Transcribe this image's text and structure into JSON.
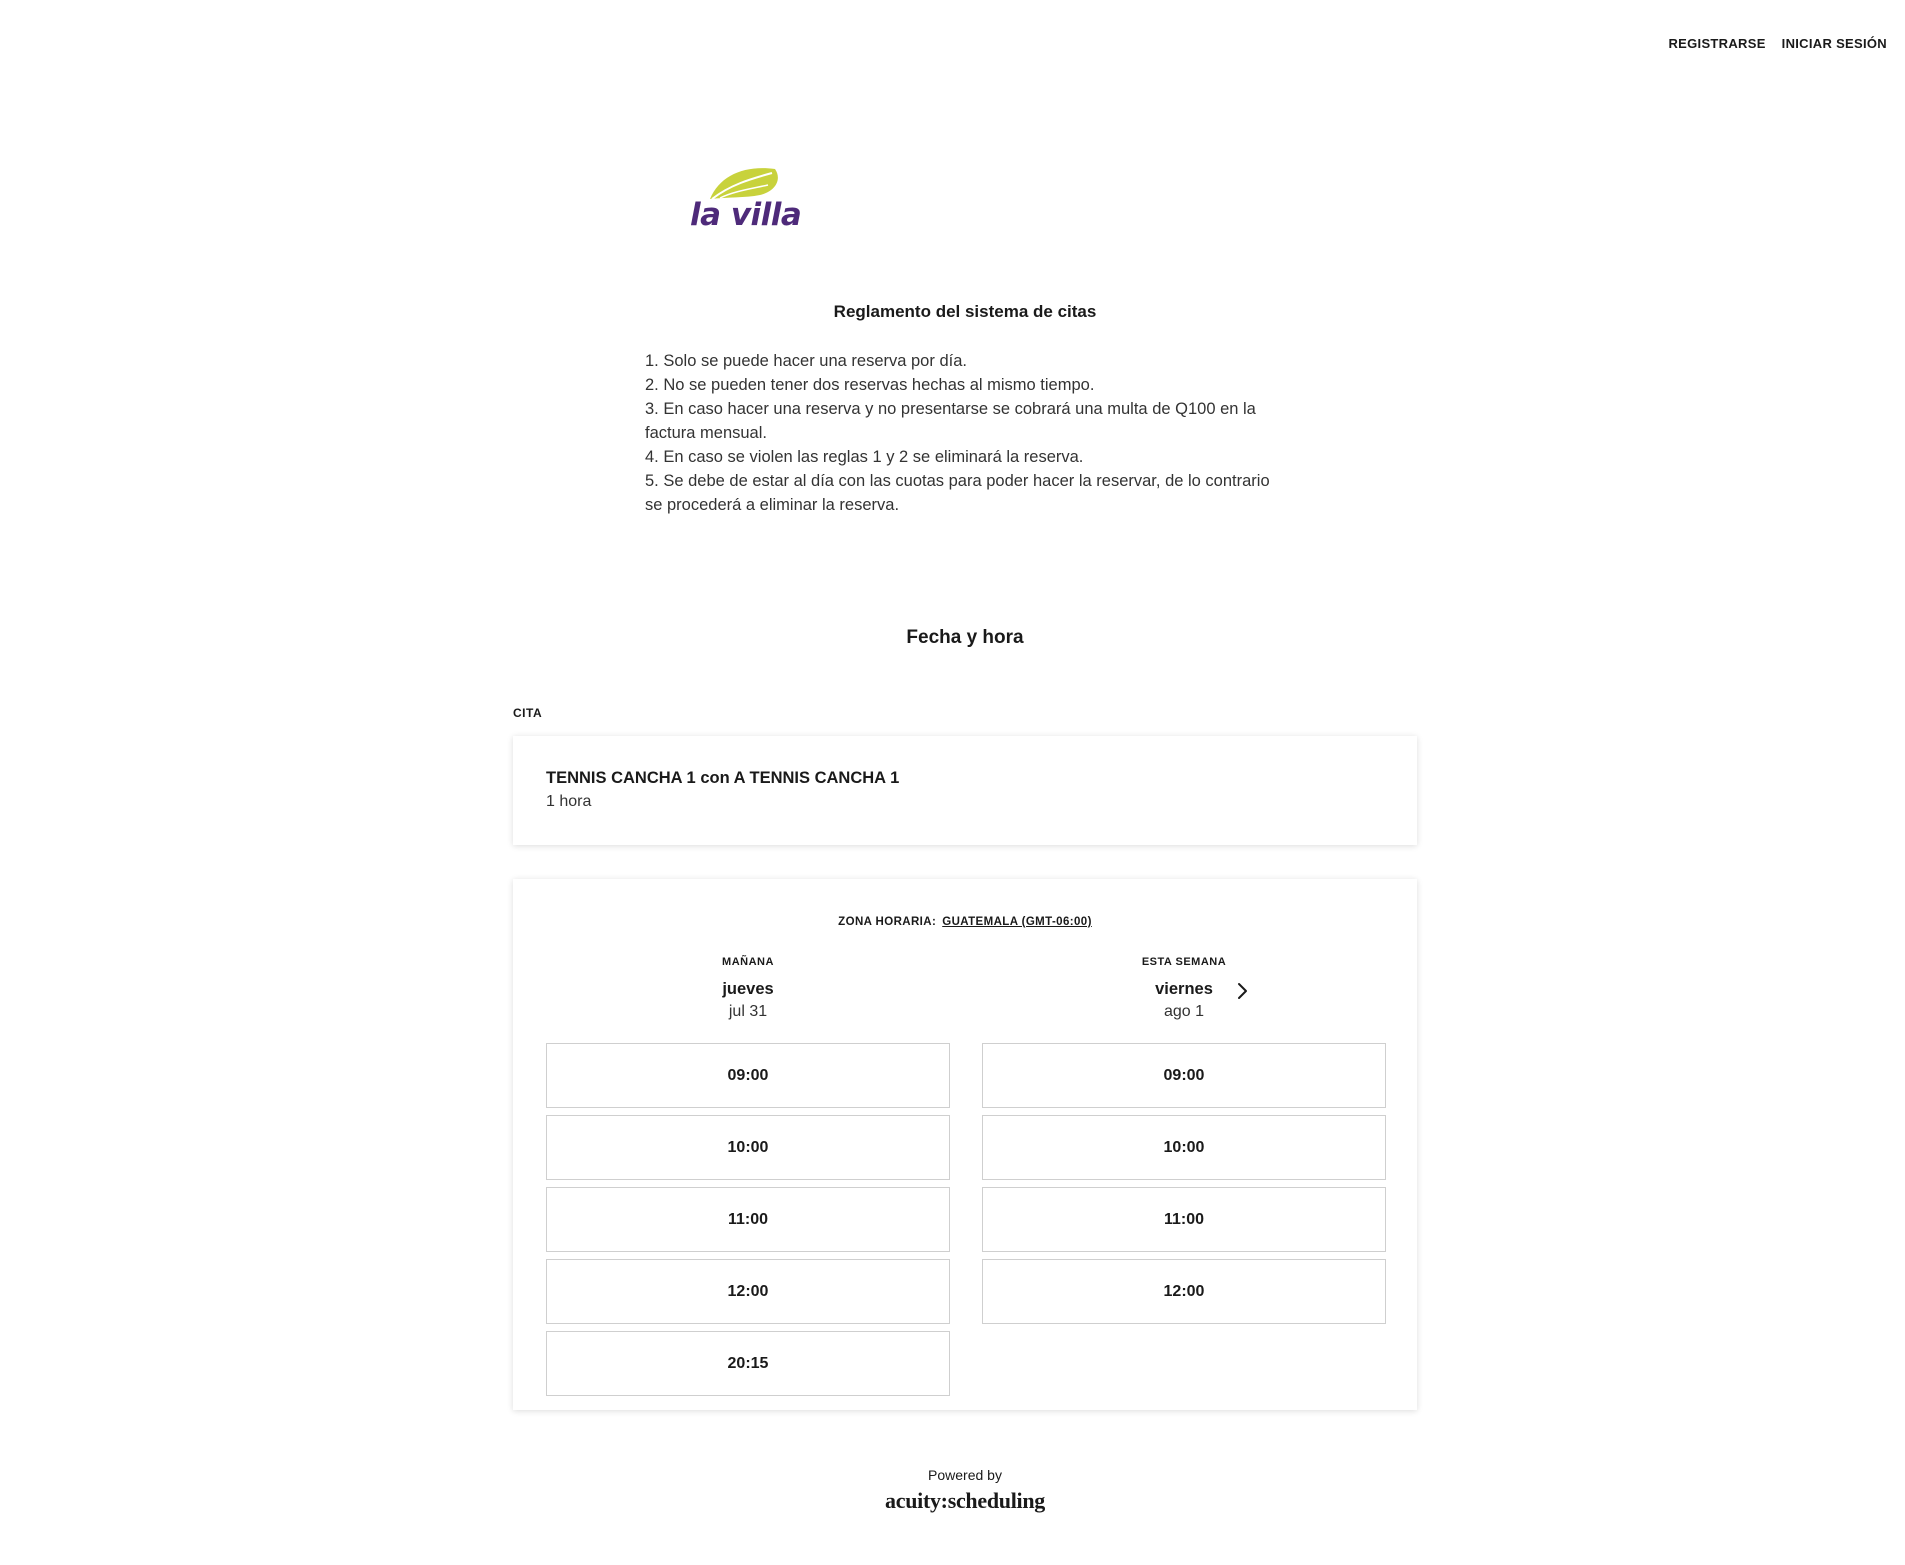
{
  "topnav": {
    "register": "REGISTRARSE",
    "login": "INICIAR SESIÓN"
  },
  "logo": {
    "text": "la villa",
    "leaf_color": "#c8d23c",
    "text_color": "#4e2a7a"
  },
  "rules": {
    "title": "Reglamento del sistema de citas",
    "lines": [
      "1. Solo se puede hacer una reserva por día.",
      "2. No se pueden tener dos reservas hechas al mismo tiempo.",
      "3. En caso hacer una reserva y no presentarse se cobrará una multa de Q100 en la factura mensual.",
      "4. En caso se violen las reglas 1 y 2 se eliminará la reserva.",
      "5. Se debe de estar al día con las cuotas para poder hacer la reservar, de lo contrario se procederá a eliminar la reserva."
    ]
  },
  "section": {
    "title": "Fecha y hora",
    "cita_label": "CITA"
  },
  "appointment": {
    "title": "TENNIS CANCHA 1 con A TENNIS CANCHA 1",
    "duration": "1 hora"
  },
  "timezone": {
    "label": "ZONA HORARIA:",
    "value": "GUATEMALA (GMT-06:00)"
  },
  "days": [
    {
      "sub": "MAÑANA",
      "day": "jueves",
      "date": "jul 31",
      "slots": [
        "09:00",
        "10:00",
        "11:00",
        "12:00",
        "20:15"
      ]
    },
    {
      "sub": "ESTA SEMANA",
      "day": "viernes",
      "date": "ago 1",
      "slots": [
        "09:00",
        "10:00",
        "11:00",
        "12:00"
      ]
    }
  ],
  "footer": {
    "powered": "Powered by",
    "brand": "acuity:scheduling"
  }
}
